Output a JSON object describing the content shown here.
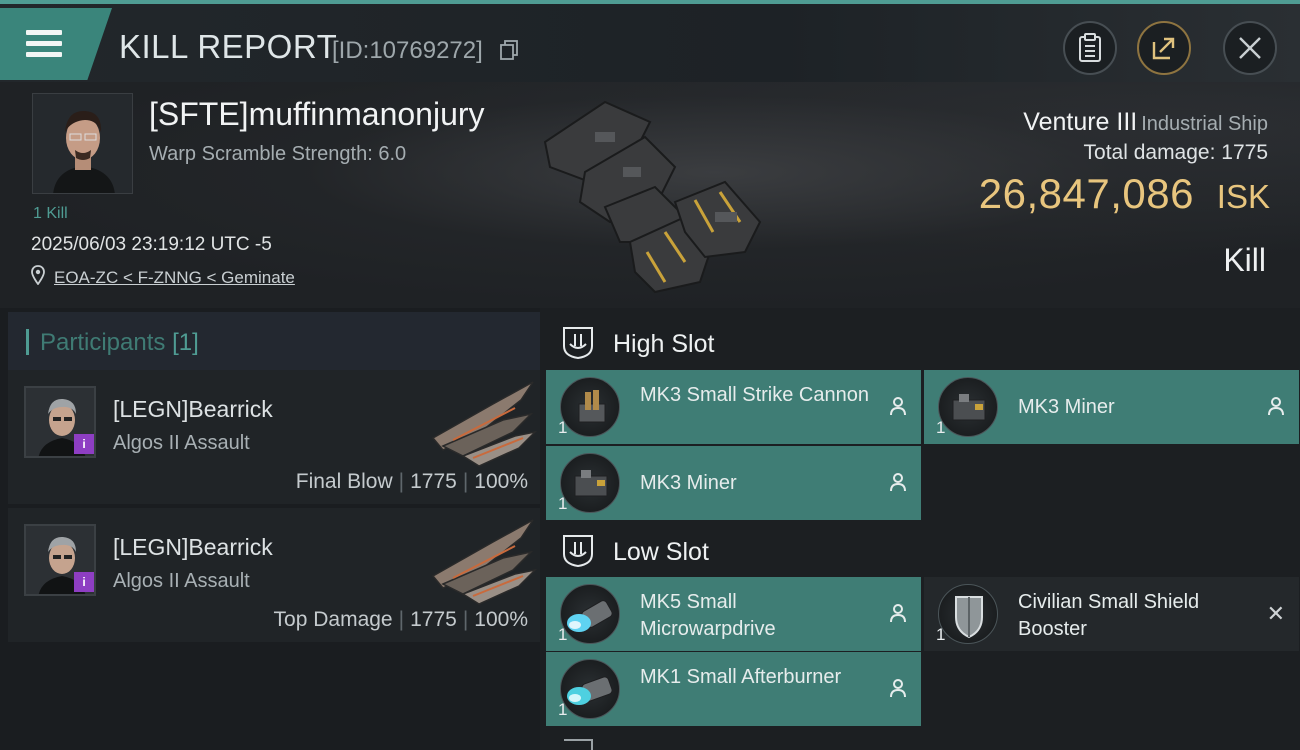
{
  "header": {
    "title": "KILL REPORT",
    "report_id": "[ID:10769272]"
  },
  "victim": {
    "pilot_name": "[SFTE]muffinmanonjury",
    "scramble_strength": "Warp Scramble Strength: 6.0",
    "kill_count": "1 Kill",
    "timestamp": "2025/06/03 23:19:12 UTC -5",
    "location": "EOA-ZC < F-ZNNG < Geminate",
    "ship_name": "Venture III",
    "ship_class": "Industrial Ship",
    "total_damage_label": "Total damage:",
    "total_damage_value": "1775",
    "isk_value": "26,847,086",
    "isk_unit": "ISK",
    "outcome": "Kill"
  },
  "participants": {
    "label": "Participants",
    "count": "[1]",
    "items": [
      {
        "name": "[LEGN]Bearrick",
        "ship": "Algos II Assault",
        "badge": "i",
        "role": "Final Blow",
        "damage": "1775",
        "percent": "100%"
      },
      {
        "name": "[LEGN]Bearrick",
        "ship": "Algos II Assault",
        "badge": "i",
        "role": "Top Damage",
        "damage": "1775",
        "percent": "100%"
      }
    ]
  },
  "fitting": {
    "high_slot": {
      "label": "High Slot",
      "modules": [
        {
          "name": "MK3 Small Strike Cannon",
          "qty": "1"
        },
        {
          "name": "MK3 Miner",
          "qty": "1"
        },
        {
          "name": "MK3 Miner",
          "qty": "1"
        }
      ]
    },
    "low_slot": {
      "label": "Low Slot",
      "modules": [
        {
          "name": "MK5 Small Microwarpdrive",
          "qty": "1"
        },
        {
          "name": "Civilian Small Shield Booster",
          "qty": "1"
        },
        {
          "name": "MK1 Small Afterburner",
          "qty": "1"
        }
      ]
    }
  },
  "colors": {
    "accent_teal": "#4f9c93",
    "module_active": "#3f7d75",
    "isk_gold": "#e8c57e",
    "badge_purple": "#8e3ec3"
  }
}
